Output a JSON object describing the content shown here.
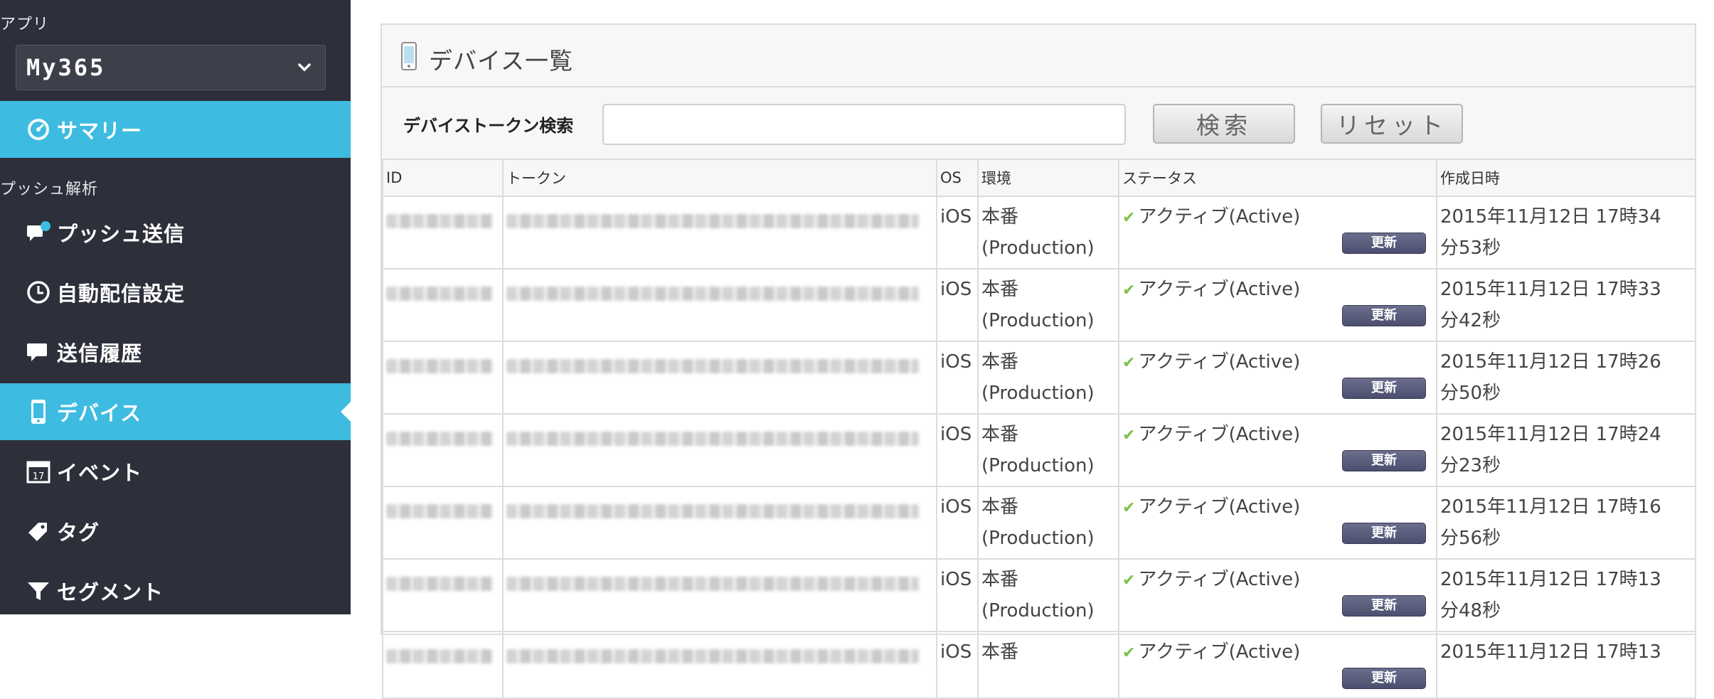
{
  "sidebar": {
    "app_section_label": "アプリ",
    "app_selected": "My365",
    "summary_label": "サマリー",
    "push_section_label": "プッシュ解析",
    "items": [
      {
        "label": "プッシュ送信",
        "icon": "push-send-icon"
      },
      {
        "label": "自動配信設定",
        "icon": "clock-icon"
      },
      {
        "label": "送信履歴",
        "icon": "chat-icon"
      },
      {
        "label": "デバイス",
        "icon": "smartphone-icon",
        "active": true
      },
      {
        "label": "イベント",
        "icon": "calendar-icon"
      },
      {
        "label": "タグ",
        "icon": "tag-icon"
      },
      {
        "label": "セグメント",
        "icon": "filter-icon"
      }
    ],
    "active_color": "#3dbbe0"
  },
  "panel": {
    "title": "デバイス一覧",
    "search_label": "デバイストークン検索",
    "search_value": "",
    "search_button": "検索",
    "reset_button": "リセット"
  },
  "table": {
    "headers": {
      "id": "ID",
      "token": "トークン",
      "os": "OS",
      "env": "環境",
      "status": "ステータス",
      "created": "作成日時"
    },
    "update_label": "更新",
    "rows": [
      {
        "os": "iOS",
        "env1": "本番",
        "env2": "(Production)",
        "status": "アクティブ(Active)",
        "created1": "2015年11月12日 17時34",
        "created2": "分53秒"
      },
      {
        "os": "iOS",
        "env1": "本番",
        "env2": "(Production)",
        "status": "アクティブ(Active)",
        "created1": "2015年11月12日 17時33",
        "created2": "分42秒"
      },
      {
        "os": "iOS",
        "env1": "本番",
        "env2": "(Production)",
        "status": "アクティブ(Active)",
        "created1": "2015年11月12日 17時26",
        "created2": "分50秒"
      },
      {
        "os": "iOS",
        "env1": "本番",
        "env2": "(Production)",
        "status": "アクティブ(Active)",
        "created1": "2015年11月12日 17時24",
        "created2": "分23秒"
      },
      {
        "os": "iOS",
        "env1": "本番",
        "env2": "(Production)",
        "status": "アクティブ(Active)",
        "created1": "2015年11月12日 17時16",
        "created2": "分56秒"
      },
      {
        "os": "iOS",
        "env1": "本番",
        "env2": "(Production)",
        "status": "アクティブ(Active)",
        "created1": "2015年11月12日 17時13",
        "created2": "分48秒"
      },
      {
        "os": "iOS",
        "env1": "本番",
        "env2": "",
        "status": "アクティブ(Active)",
        "created1": "2015年11月12日 17時13",
        "created2": ""
      }
    ]
  }
}
